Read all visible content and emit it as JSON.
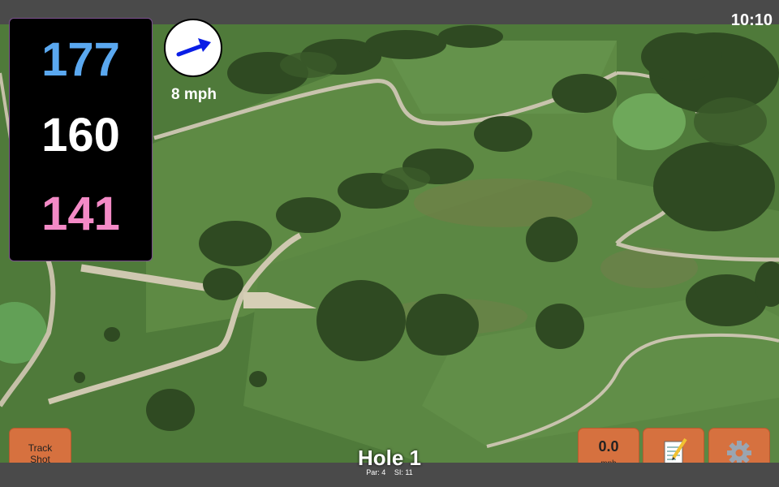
{
  "status": {
    "time": "10:10"
  },
  "distances": {
    "back": "177",
    "middle": "160",
    "front": "141",
    "colors": {
      "back": "#5aa8f0",
      "middle": "#ffffff",
      "front": "#f38ac6"
    }
  },
  "wind": {
    "speed_label": "8 mph",
    "arrow_icon": "wind-direction-arrow-icon",
    "arrow_color": "#0a1ee6"
  },
  "buttons": {
    "track_line1": "Track",
    "track_line2": "Shot",
    "speed_value": "0.0",
    "speed_unit": "mph",
    "notes_icon": "notepad-icon",
    "settings_icon": "gear-icon",
    "accent": "#d6713f"
  },
  "hole": {
    "title": "Hole 1",
    "par": "Par: 4",
    "si": "SI: 11"
  },
  "map": {
    "type": "satellite-golf-course"
  }
}
